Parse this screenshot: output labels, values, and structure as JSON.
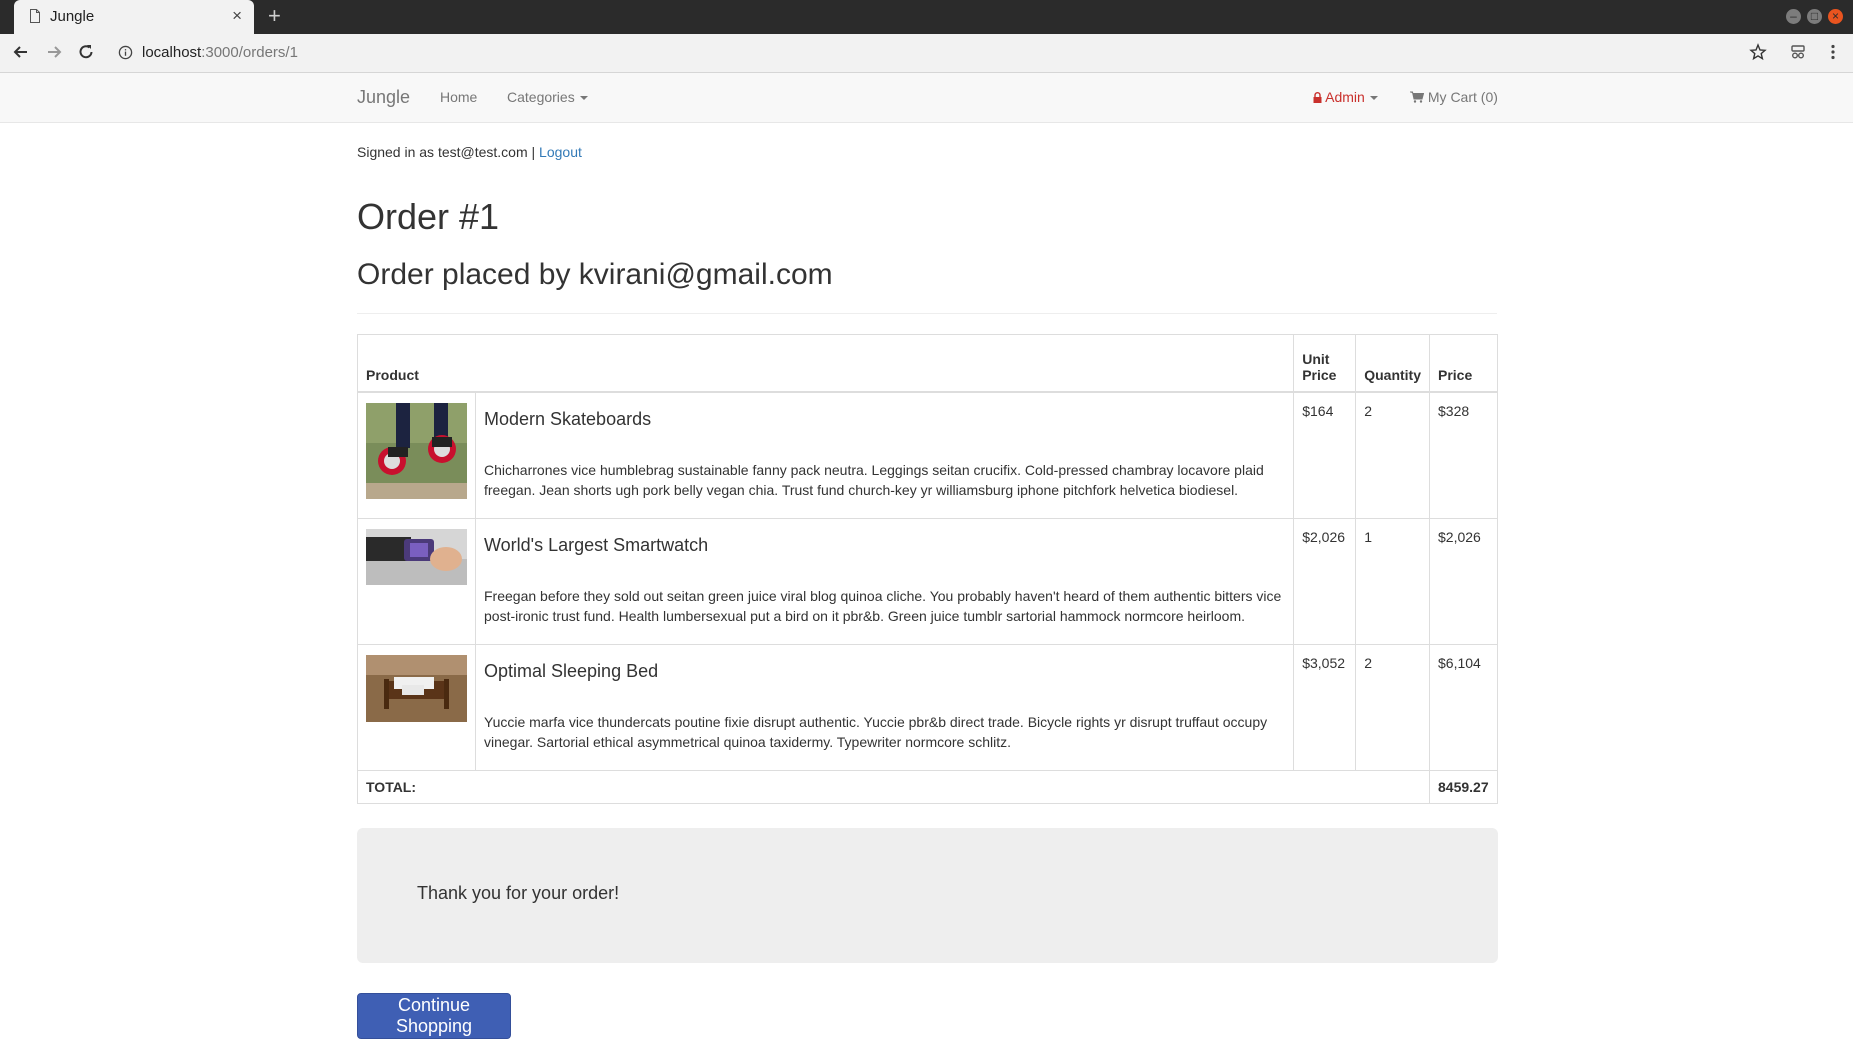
{
  "browser": {
    "tab_title": "Jungle",
    "url_host": "localhost",
    "url_path": ":3000/orders/1",
    "close_glyph": "×",
    "newtab_glyph": "+"
  },
  "navbar": {
    "brand": "Jungle",
    "home": "Home",
    "categories": "Categories",
    "admin": "Admin",
    "cart": "My Cart (0)",
    "admin_color": "#c9302c"
  },
  "session": {
    "signed_in_text": "Signed in as test@test.com |",
    "logout": "Logout"
  },
  "order": {
    "title": "Order #1",
    "placed_by": "Order placed by kvirani@gmail.com",
    "headers": {
      "product": "Product",
      "unit_price": "Unit Price",
      "quantity": "Quantity",
      "price": "Price"
    },
    "items": [
      {
        "name": "Modern Skateboards",
        "description": "Chicharrones vice humblebrag sustainable fanny pack neutra. Leggings seitan crucifix. Cold-pressed chambray locavore plaid freegan. Jean shorts ugh pork belly vegan chia. Trust fund church-key yr williamsburg iphone pitchfork helvetica biodiesel.",
        "unit_price": "$164",
        "quantity": "2",
        "price": "$328",
        "image": "skateboard-photo"
      },
      {
        "name": "World's Largest Smartwatch",
        "description": "Freegan before they sold out seitan green juice viral blog quinoa cliche. You probably haven't heard of them authentic bitters vice post-ironic trust fund. Health lumbersexual put a bird on it pbr&b. Green juice tumblr sartorial hammock normcore heirloom.",
        "unit_price": "$2,026",
        "quantity": "1",
        "price": "$2,026",
        "image": "smartwatch-photo"
      },
      {
        "name": "Optimal Sleeping Bed",
        "description": "Yuccie marfa vice thundercats poutine fixie disrupt authentic. Yuccie pbr&b direct trade. Bicycle rights yr disrupt truffaut occupy vinegar. Sartorial ethical asymmetrical quinoa taxidermy. Typewriter normcore schlitz.",
        "unit_price": "$3,052",
        "quantity": "2",
        "price": "$6,104",
        "image": "bed-photo"
      }
    ],
    "total_label": "TOTAL:",
    "total_value": "8459.27"
  },
  "thank_you": "Thank you for your order!",
  "continue_button": "Continue Shopping",
  "colors": {
    "primary_button": "#3f5fb4",
    "link": "#337ab7"
  }
}
